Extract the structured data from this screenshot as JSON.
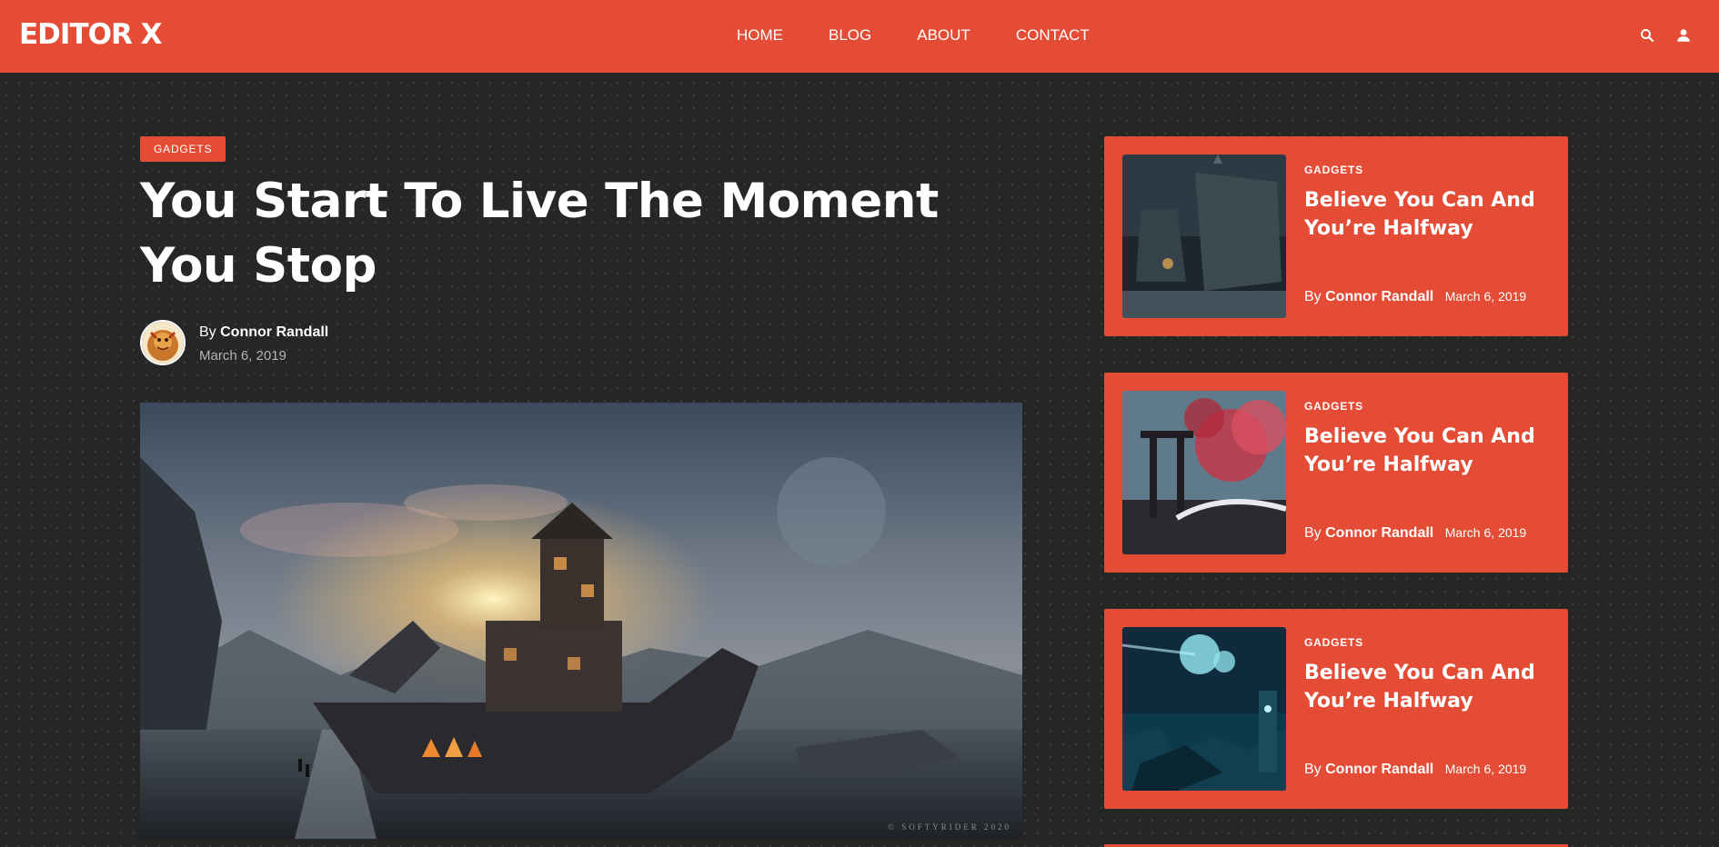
{
  "header": {
    "logo": "EDITOR X",
    "nav": [
      "HOME",
      "BLOG",
      "ABOUT",
      "CONTACT"
    ],
    "icons": [
      "search-icon",
      "user-icon"
    ]
  },
  "article": {
    "category": "GADGETS",
    "title": "You Start To Live The Moment You Stop",
    "author_prefix": "By",
    "author": "Connor Randall",
    "date": "March 6, 2019",
    "image_watermark": "© SOFTYRIDER 2020"
  },
  "sidebar": {
    "cards": [
      {
        "category": "GADGETS",
        "title": "Believe You Can And You’re Halfway",
        "author_prefix": "By",
        "author": "Connor Randall",
        "date": "March 6, 2019"
      },
      {
        "category": "GADGETS",
        "title": "Believe You Can And You’re Halfway",
        "author_prefix": "By",
        "author": "Connor Randall",
        "date": "March 6, 2019"
      },
      {
        "category": "GADGETS",
        "title": "Believe You Can And You’re Halfway",
        "author_prefix": "By",
        "author": "Connor Randall",
        "date": "March 6, 2019"
      }
    ]
  },
  "colors": {
    "accent": "#e44c36",
    "background": "#262626",
    "text": "#ffffff",
    "muted_text": "#b5b5b5"
  }
}
